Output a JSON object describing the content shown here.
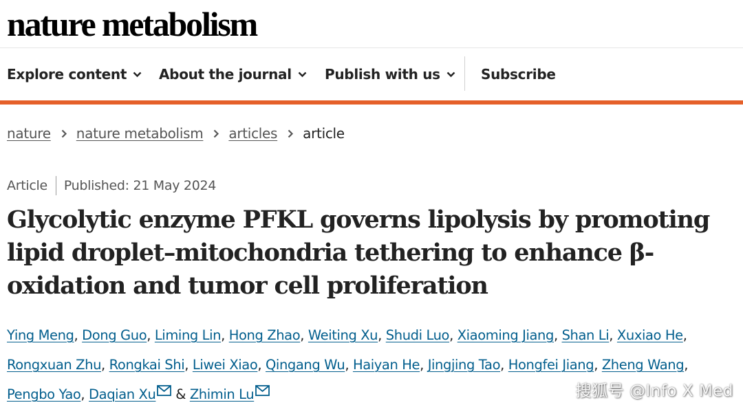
{
  "header": {
    "logo_text": "nature metabolism"
  },
  "nav": {
    "items": [
      {
        "label": "Explore content",
        "has_dropdown": true
      },
      {
        "label": "About the journal",
        "has_dropdown": true
      },
      {
        "label": "Publish with us",
        "has_dropdown": true
      },
      {
        "label": "Subscribe",
        "has_dropdown": false
      }
    ],
    "accent_color": "#e5602a"
  },
  "breadcrumb": {
    "items": [
      "nature",
      "nature metabolism",
      "articles"
    ],
    "current": "article"
  },
  "meta": {
    "type": "Article",
    "published": "Published: 21 May 2024"
  },
  "article": {
    "title": "Glycolytic enzyme PFKL governs lipolysis by promoting lipid droplet–mitochondria tethering to enhance β-oxidation and tumor cell proliferation"
  },
  "authors": {
    "list": [
      "Ying Meng",
      "Dong Guo",
      "Liming Lin",
      "Hong Zhao",
      "Weiting Xu",
      "Shudi Luo",
      "Xiaoming Jiang",
      "Shan Li",
      "Xuxiao He",
      "Rongxuan Zhu",
      "Rongkai Shi",
      "Liwei Xiao",
      "Qingang Wu",
      "Haiyan He",
      "Jingjing Tao",
      "Hongfei Jiang",
      "Zheng Wang",
      "Pengbo Yao",
      "Daqian Xu",
      "Zhimin Lu"
    ],
    "corresponding": [
      "Daqian Xu",
      "Zhimin Lu"
    ],
    "separator": ", ",
    "last_separator": " & ",
    "link_color": "#025e8d"
  },
  "watermark": {
    "text": "搜狐号 @Info X Med"
  },
  "icons": {
    "dropdown": "chevron-down-icon",
    "breadcrumb_separator": "chevron-right-icon",
    "email": "mail-icon"
  }
}
